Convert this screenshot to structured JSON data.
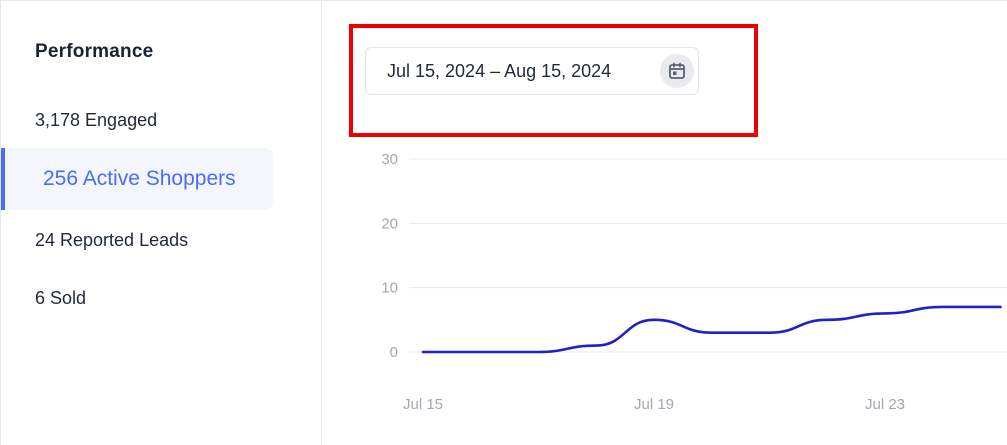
{
  "sidebar": {
    "title": "Performance",
    "items": [
      {
        "label": "3,178 Engaged",
        "active": false
      },
      {
        "label": "256 Active Shoppers",
        "active": true
      },
      {
        "label": "24 Reported Leads",
        "active": false
      },
      {
        "label": "6 Sold",
        "active": false
      }
    ]
  },
  "date_range": {
    "value": "Jul 15, 2024  –  Aug 15, 2024",
    "icon": "calendar-icon"
  },
  "colors": {
    "accent": "#4a6cf7",
    "line": "#2020c8",
    "highlight": "#ee0000"
  },
  "chart_data": {
    "type": "line",
    "x": [
      "Jul 15",
      "Jul 16",
      "Jul 17",
      "Jul 18",
      "Jul 19",
      "Jul 20",
      "Jul 21",
      "Jul 22",
      "Jul 23",
      "Jul 24",
      "Jul 25"
    ],
    "series": [
      {
        "values": [
          0,
          0,
          0,
          1,
          5,
          3,
          3,
          5,
          6,
          7,
          7
        ]
      }
    ],
    "xticks": [
      "Jul 15",
      "Jul 19",
      "Jul 23"
    ],
    "yticks": [
      0,
      10,
      20,
      30
    ],
    "ylim": [
      0,
      30
    ],
    "title": "",
    "xlabel": "",
    "ylabel": "",
    "grid": true
  }
}
